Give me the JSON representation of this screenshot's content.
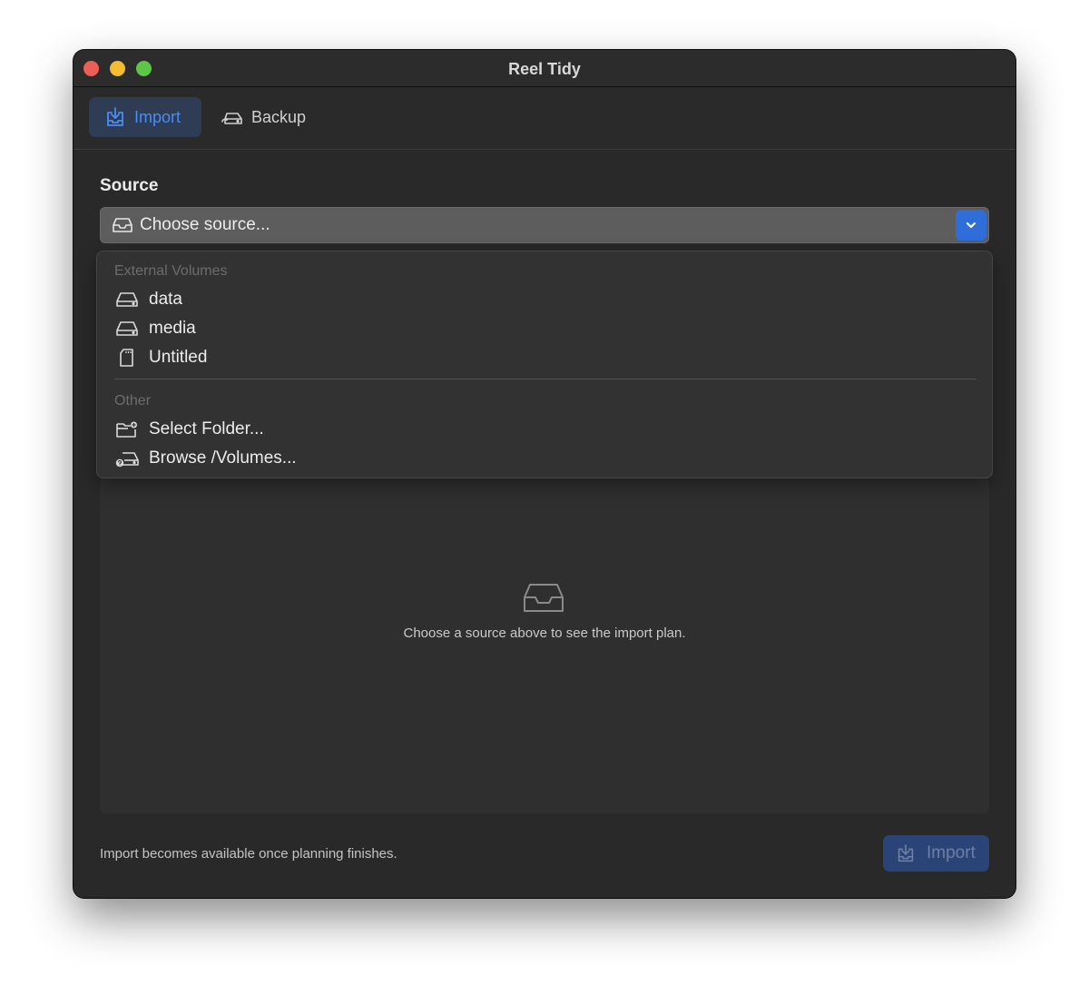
{
  "window": {
    "title": "Reel Tidy"
  },
  "tabs": [
    {
      "label": "Import",
      "icon": "import-icon",
      "selected": true
    },
    {
      "label": "Backup",
      "icon": "drive-backup-icon",
      "selected": false
    }
  ],
  "source": {
    "label": "Source",
    "select_value": "Choose source...",
    "select_icon": "inbox-icon"
  },
  "dropdown": {
    "sections": [
      {
        "title": "External Volumes",
        "items": [
          {
            "label": "data",
            "icon": "external-drive-icon"
          },
          {
            "label": "media",
            "icon": "external-drive-icon"
          },
          {
            "label": "Untitled",
            "icon": "sd-card-icon"
          }
        ]
      },
      {
        "title": "Other",
        "items": [
          {
            "label": "Select Folder...",
            "icon": "folder-badge-plus-icon"
          },
          {
            "label": "Browse /Volumes...",
            "icon": "drive-question-icon"
          }
        ]
      }
    ]
  },
  "plan_panel": {
    "empty_icon": "tray-icon",
    "empty_message": "Choose a source above to see the import plan."
  },
  "footer": {
    "status": "Import becomes available once planning finishes.",
    "import_button": "Import"
  },
  "colors": {
    "accent": "#2f6ed9",
    "tab_selected_bg": "#2e3d54",
    "tab_selected_text": "#4a8cf5",
    "window_bg": "#292929"
  }
}
